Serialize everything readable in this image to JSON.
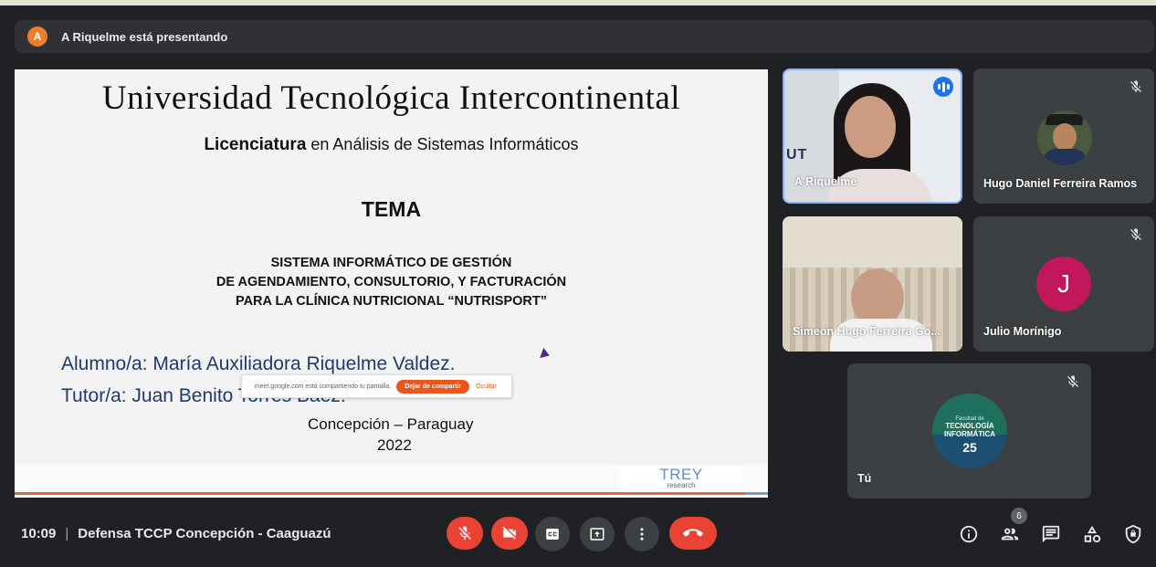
{
  "presenting": {
    "avatar_letter": "A",
    "text": "A Riquelme está presentando"
  },
  "slide": {
    "university": "Universidad Tecnológica Intercontinental",
    "degree_prefix": "Licenciatura",
    "degree_rest": " en Análisis de Sistemas Informáticos",
    "tema": "TEMA",
    "system_line1": "SISTEMA INFORMÁTICO DE GESTIÓN",
    "system_line2": "DE AGENDAMIENTO, CONSULTORIO, Y FACTURACIÓN",
    "system_line3": "PARA LA CLÍNICA NUTRICIONAL “NUTRISPORT”",
    "alumno": "Alumno/a: María Auxiliadora Riquelme Valdez.",
    "tutor": "Tutor/a: Juan Benito Torres Báez.",
    "lugar": "Concepción – Paraguay",
    "year": "2022",
    "brand": "TREY",
    "brand_sub": "research"
  },
  "share_banner": {
    "grip": "⦙",
    "text": "meet.google.com está compartiendo tu pantalla.",
    "stop_label": "Dejar de compartir",
    "hide_label": "Ocultar"
  },
  "participants": [
    {
      "name": "A Riquelme",
      "speaking": true,
      "banner_text": "UT"
    },
    {
      "name": "Hugo Daniel Ferreira Ramos",
      "muted": true
    },
    {
      "name": "Simeón Hugo Ferreira Go...",
      "muted": false
    },
    {
      "name": "Julio Morínigo",
      "muted": true,
      "avatar_letter": "J",
      "avatar_color": "#c2185b"
    },
    {
      "name": "Tú",
      "muted": true,
      "logo_line1": "Facultad de",
      "logo_line2": "TECNOLOGÍA",
      "logo_line3": "INFORMÁTICA",
      "logo_num": "25"
    }
  ],
  "bottom": {
    "time": "10:09",
    "separator": "|",
    "meeting_title": "Defensa TCCP Concepción - Caaguazú",
    "participant_count": "6"
  },
  "colors": {
    "danger": "#ea4335",
    "bar": "#202124",
    "accent": "#8ab4f8"
  }
}
